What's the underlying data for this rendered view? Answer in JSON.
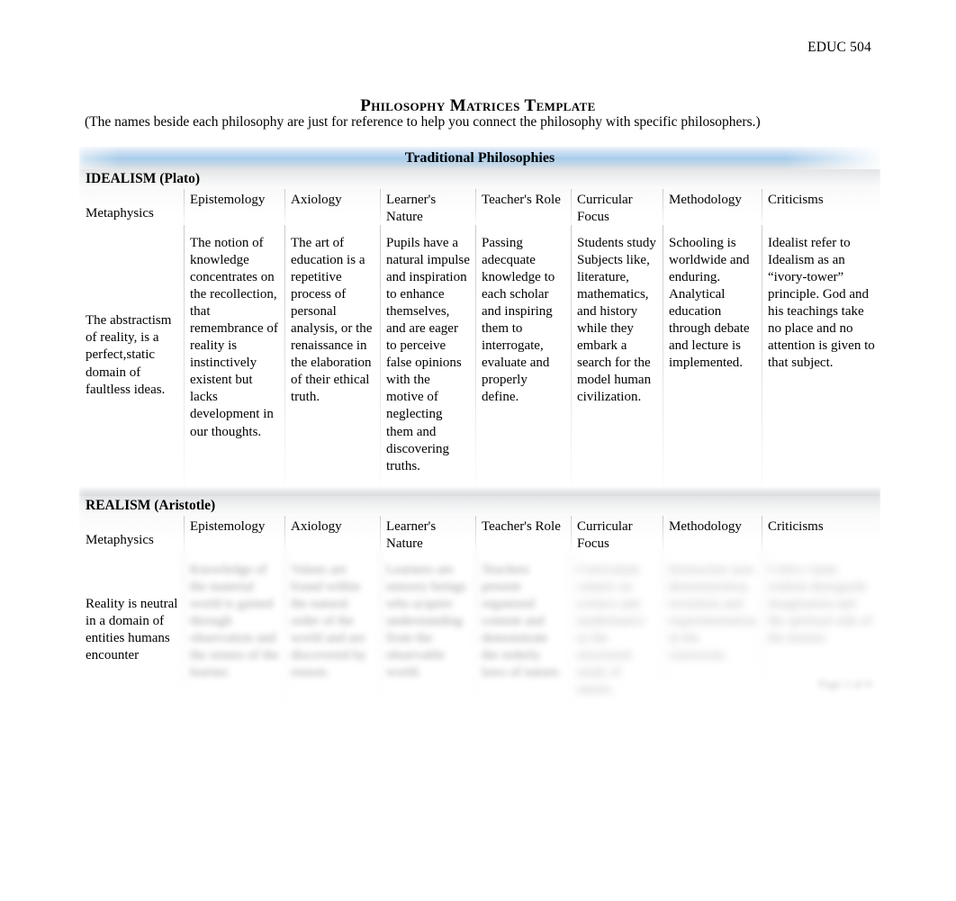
{
  "header": {
    "course_code": "EDUC 504",
    "title": "Philosophy Matrices Template",
    "subtitle": "(The names beside each philosophy are just for reference to help you connect the philosophy with specific philosophers.)"
  },
  "footer": {
    "page_label": "Page 1 of 4"
  },
  "matrix": {
    "banner": "Traditional Philosophies",
    "columns": [
      "Metaphysics",
      "Epistemology",
      "Axiology",
      "Learner's Nature",
      "Teacher's Role",
      "Curricular Focus",
      "Methodology",
      "Criticisms"
    ],
    "sections": [
      {
        "label": "IDEALISM (Plato)",
        "legible": true,
        "cells": [
          "The abstractism of reality, is a perfect,static domain of faultless ideas.",
          "The notion of knowledge concentrates on the recollection, that remembrance of reality is instinctively existent but lacks development in our thoughts.",
          "The art of education is a repetitive process of personal analysis, or the renaissance in the elaboration of their ethical truth.",
          "Pupils have a natural impulse and inspiration to enhance themselves, and are eager to perceive false opinions with the motive of neglecting them and discovering truths.",
          "Passing adecquate knowledge to each scholar and inspiring them to interrogate, evaluate and properly define.",
          "Students study Subjects like, literature, mathematics, and history while they embark a search for the model human civilization.",
          "Schooling is worldwide and enduring. Analytical education through debate and lecture is implemented.",
          "Idealist refer to Idealism as an “ivory-tower” principle. God and his teachings take no place and no attention is given to that subject."
        ]
      },
      {
        "label": "REALISM (Aristotle)",
        "legible": false,
        "cells": [
          "Reality is neutral in a domain of entities humans encounter",
          "Knowledge of the material world is gained through observation and the senses of the learner.",
          "Values are found within the natural order of the world and are discovered by reason.",
          "Learners are sensory beings who acquire understanding from the observable world.",
          "Teachers present organized content and demonstrate the orderly laws of nature.",
          "Curriculum centers on science and mathematics as the structured study of nature.",
          "Instruction uses demonstration, recitation and experimentation in the classroom.",
          "Critics claim realism disregards imagination and the spiritual side of the learner."
        ]
      }
    ]
  }
}
